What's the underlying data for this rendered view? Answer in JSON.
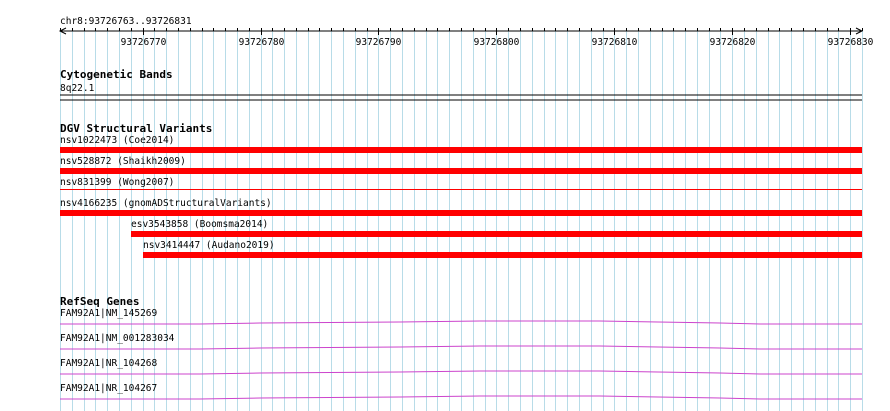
{
  "locus": "chr8:93726763..93726831",
  "ruler": {
    "start": 93726763,
    "end": 93726831,
    "tick_labels": [
      "93726770",
      "93726780",
      "93726790",
      "93726800",
      "93726810",
      "93726820",
      "93726830"
    ]
  },
  "tracks": {
    "cytoband": {
      "title": "Cytogenetic Bands",
      "band": "8q22.1"
    },
    "dgv": {
      "title": "DGV Structural Variants",
      "bar_color": "#ff0000",
      "features": [
        {
          "label": "nsv1022473 (Coe2014)",
          "start": 93726763,
          "end": 93726831
        },
        {
          "label": "nsv528872 (Shaikh2009)",
          "start": 93726763,
          "end": 93726831
        },
        {
          "label": "nsv831399 (Wong2007)",
          "start": 93726763,
          "end": 93726831
        },
        {
          "label": "nsv4166235 (gnomADStructuralVariants)",
          "start": 93726763,
          "end": 93726831
        },
        {
          "label": "esv3543858 (Boomsma2014)",
          "start": 93726769,
          "end": 93726831
        },
        {
          "label": "nsv3414447 (Audano2019)",
          "start": 93726770,
          "end": 93726831
        }
      ]
    },
    "refseq": {
      "title": "RefSeq Genes",
      "line_color": "#cc44cc",
      "features": [
        {
          "label": "FAM92A1|NM_145269"
        },
        {
          "label": "FAM92A1|NM_001283034"
        },
        {
          "label": "FAM92A1|NR_104268"
        },
        {
          "label": "FAM92A1|NR_104267"
        }
      ]
    }
  },
  "colors": {
    "grid": "#b8dce8",
    "text": "#000000"
  }
}
